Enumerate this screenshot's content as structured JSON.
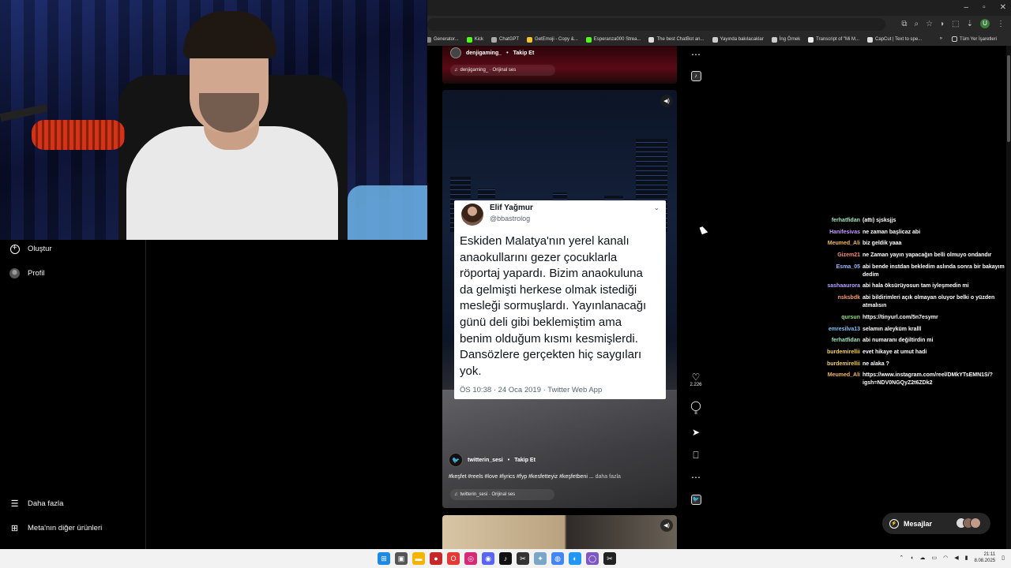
{
  "browser": {
    "bookmarks": [
      {
        "label": "Generator...",
        "color": "#888888"
      },
      {
        "label": "Kick",
        "color": "#53fc18"
      },
      {
        "label": "ChatGPT",
        "color": "#aaaaaa"
      },
      {
        "label": "GetEmoji - Copy &...",
        "color": "#f4c430"
      },
      {
        "label": "Esperanza000 Strea...",
        "color": "#53fc18"
      },
      {
        "label": "The best ChatBot an...",
        "color": "#dddddd"
      },
      {
        "label": "Yayında bakılacaklar",
        "color": "#cccccc"
      },
      {
        "label": "İng Örnek",
        "color": "#cccccc"
      },
      {
        "label": "Transcript of \"Mi M...",
        "color": "#eeeeee"
      },
      {
        "label": "CapCut | Text to spe...",
        "color": "#dddddd"
      }
    ],
    "all_bookmarks": "Tüm Yer İşaretleri",
    "profile_initial": "U"
  },
  "sidebar": {
    "create_label": "Oluştur",
    "profile_label": "Profil",
    "more_label": "Daha fazla",
    "meta_label": "Meta'nın diğer ürünleri"
  },
  "prev_reel": {
    "username": "denjigaming_",
    "follow": "Takip Et",
    "audio": "denjigaming_ · Orijinal ses"
  },
  "reel": {
    "tweet": {
      "name": "Elif Yağmur",
      "handle": "@bbastrolog",
      "text": "Eskiden Malatya'nın yerel kanalı\nanaokullarını gezer çocuklarla\nröportaj yapardı. Bizim anaokuluna\nda gelmişti herkese olmak istediği\nmesleği sormuşlardı. Yayınlanacağı\ngünü deli gibi beklemiştim ama\nbenim olduğum kısmı kesmişlerdi.\nDansözlere gerçekten hiç saygıları\nyok.",
      "meta": "ÖS 10:38 · 24 Oca 2019 · Twitter Web App"
    },
    "username": "twitterin_sesi",
    "follow": "Takip Et",
    "tags": "#keşfet #reels #love #lyrics #fyp #kesfetteyiz #keşfetbeni ...",
    "more": "daha fazla",
    "audio": "twitterin_sesi · Orijinal ses",
    "likes": "2.226",
    "comments": "8"
  },
  "chat": [
    {
      "user": "ferhatfidan",
      "color": "#9ee6c0",
      "msg": "(attı) sjsksjjs"
    },
    {
      "user": "Hanifesivas",
      "color": "#c39bff",
      "msg": "ne zaman başlicaz abi"
    },
    {
      "user": "Meumed_Ali",
      "color": "#f4b860",
      "msg": "biz geldik yaaa"
    },
    {
      "user": "Gizem21",
      "color": "#ff8c7a",
      "msg": "ne Zaman yayın yapacağın belli olmuyo ondandır"
    },
    {
      "user": "Esma_05",
      "color": "#9ab8ff",
      "msg": "abi bende instdan bekledim aslında sonra bir bakayım dedim"
    },
    {
      "user": "sashaaurora",
      "color": "#b7a6ff",
      "msg": "abi hala öksürüyosun tam iyleşmedin mi"
    },
    {
      "user": "nsksbdk",
      "color": "#ff9e6b",
      "msg": "abi bildirimleri açık olmayan oluyor belki o yüzden atmalısın"
    },
    {
      "user": "qursun",
      "color": "#8fe08a",
      "msg": "https://tinyurl.com/5n7esymr"
    },
    {
      "user": "emresilva13",
      "color": "#7cc4ff",
      "msg": "selamın aleyküm kralll"
    },
    {
      "user": "ferhatfidan",
      "color": "#9ee6c0",
      "msg": "abi numaranı değiltirdin mi"
    },
    {
      "user": "burdemirellii",
      "color": "#f7d154",
      "msg": "evet hikaye at umut hadi"
    },
    {
      "user": "burdemirellii",
      "color": "#f7d154",
      "msg": "ne alaka ?"
    },
    {
      "user": "Meumed_Ali",
      "color": "#f4b860",
      "msg": "https://www.instagram.com/reel/DMkYTsEMN1S/?igsh=NDV0NGQyZ2t6ZDk2"
    }
  ],
  "messages_label": "Mesajlar",
  "taskbar": {
    "time": "21:11",
    "date": "8.08.2025"
  }
}
